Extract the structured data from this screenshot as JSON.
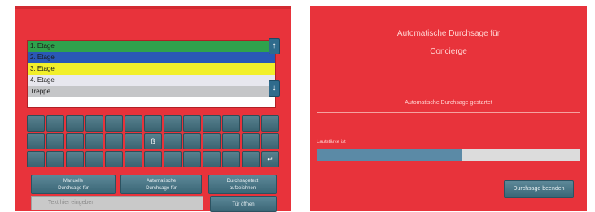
{
  "left_panel": {
    "floors": [
      {
        "label": "1. Etage",
        "color": "#2fa24c"
      },
      {
        "label": "2. Etage",
        "color": "#2a58b6"
      },
      {
        "label": "3. Etage",
        "color": "#f2ef2a"
      },
      {
        "label": "4. Etage",
        "color": "#e7e7ee"
      },
      {
        "label": "Treppe",
        "color": "#c5c6c8"
      }
    ],
    "scroll_up_label": "↑",
    "scroll_down_label": "↓",
    "keyboard": {
      "rows": [
        [
          "",
          "",
          "",
          "",
          "",
          "",
          "",
          "",
          "",
          "",
          "",
          "",
          ""
        ],
        [
          "",
          "",
          "",
          "",
          "",
          "",
          "",
          "",
          "",
          "",
          "",
          "",
          ""
        ],
        [
          "",
          "",
          "",
          "",
          "",
          "",
          "",
          "",
          "",
          "",
          "",
          "",
          "↵"
        ]
      ],
      "center_label": "ß"
    },
    "buttons": {
      "manual": "Manuelle\nDurchsage für",
      "automatic": "Automatische\nDurchsage für",
      "record": "Durchsagetext\naufzeichnen",
      "submit": "Tür öffnen"
    },
    "input_placeholder": "Text hier eingeben"
  },
  "right_panel": {
    "title_line1": "Automatische Durchsage für",
    "title_line2": "Concierge",
    "status": "Automatische Durchsage gestartet",
    "progress_label": "Lautstärke ist",
    "progress_value": 0.55,
    "action_button": "Durchsage beenden"
  }
}
